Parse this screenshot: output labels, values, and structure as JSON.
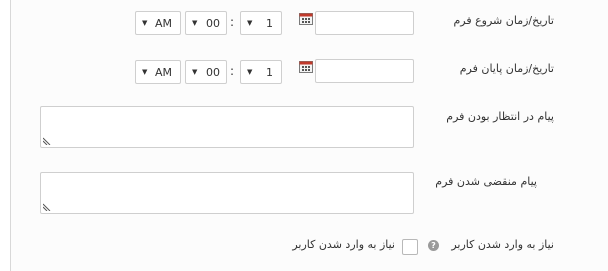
{
  "form": {
    "start": {
      "label": "تاریخ/زمان شروع فرم",
      "date_value": "",
      "hour": "1",
      "minute": "00",
      "ampm": "AM"
    },
    "end": {
      "label": "تاریخ/زمان پایان فرم",
      "date_value": "",
      "hour": "1",
      "minute": "00",
      "ampm": "AM"
    },
    "time_separator": ":",
    "pending_message": {
      "label": "پیام در انتظار بودن فرم",
      "value": ""
    },
    "expired_message": {
      "label": "پیام منقضی شدن فرم",
      "value": ""
    },
    "require_login": {
      "label": "نیاز به وارد شدن کاربر",
      "checkbox_label": "نیاز به وارد شدن کاربر",
      "checked": false,
      "help_symbol": "?"
    }
  },
  "icons": {
    "calendar": "calendar-icon",
    "dropdown": "chevron-down-icon",
    "resize": "resize-grip-icon",
    "help": "help-icon"
  }
}
